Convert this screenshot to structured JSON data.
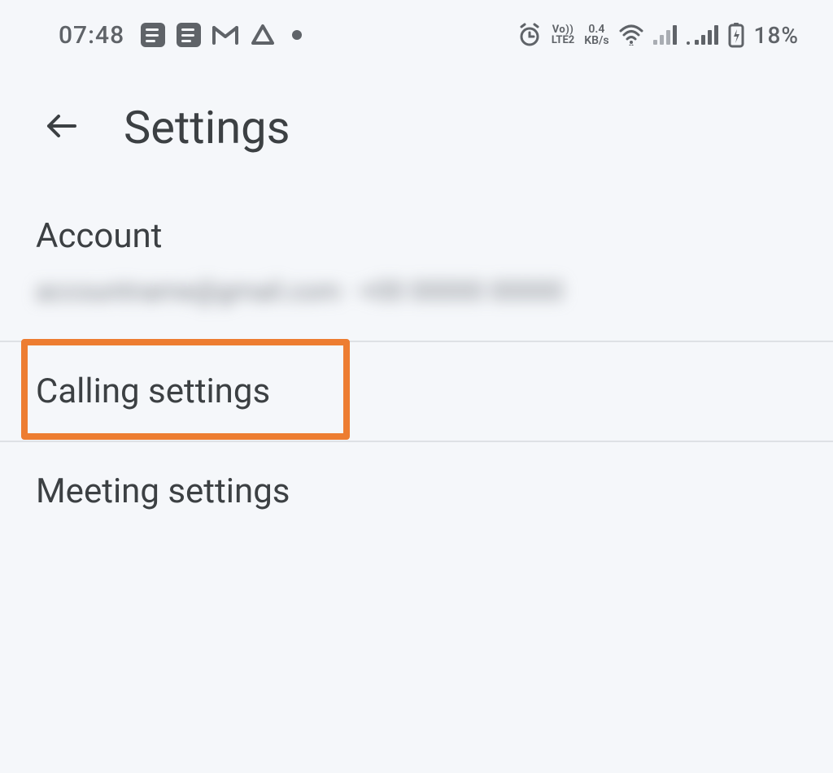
{
  "status_bar": {
    "time": "07:48",
    "lte_top": "Vo))",
    "lte_bottom": "LTE2",
    "speed_top": "0.4",
    "speed_bottom": "KB/s",
    "battery_percentage": "18%"
  },
  "app_bar": {
    "title": "Settings"
  },
  "account": {
    "label": "Account",
    "redacted_text": "accountname@gmail.com · +00 00000 00000"
  },
  "items": {
    "calling": "Calling settings",
    "meeting": "Meeting settings"
  }
}
